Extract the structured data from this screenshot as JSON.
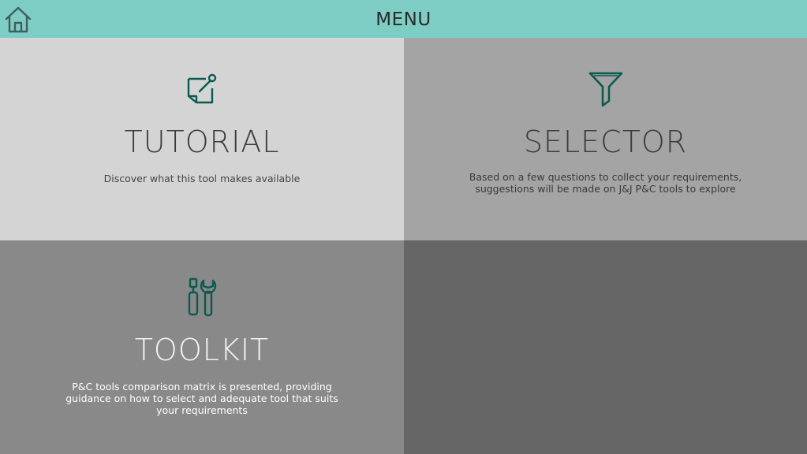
{
  "header": {
    "title": "MENU",
    "home_icon": "home-icon",
    "background": "#7ecdc4"
  },
  "tiles": {
    "tutorial": {
      "icon": "sticky-note-pin-icon",
      "title": "TUTORIAL",
      "description": "Discover what this tool makes available",
      "background": "#d4d4d4"
    },
    "selector": {
      "icon": "filter-funnel-icon",
      "title": "SELECTOR",
      "description": "Based on a few questions to collect your requirements,\nsuggestions will be made on J&J P&C tools to explore",
      "background": "#a4a4a4"
    },
    "toolkit": {
      "icon": "tools-wrench-screwdriver-icon",
      "title": "TOOLKIT",
      "description": "P&C tools comparison matrix is presented, providing\nguidance on how to select and adequate tool that suits\nyour requirements",
      "background": "#898989"
    },
    "empty": {
      "background": "#666666"
    }
  },
  "colors": {
    "icon_accent": "#0a5a4f"
  }
}
